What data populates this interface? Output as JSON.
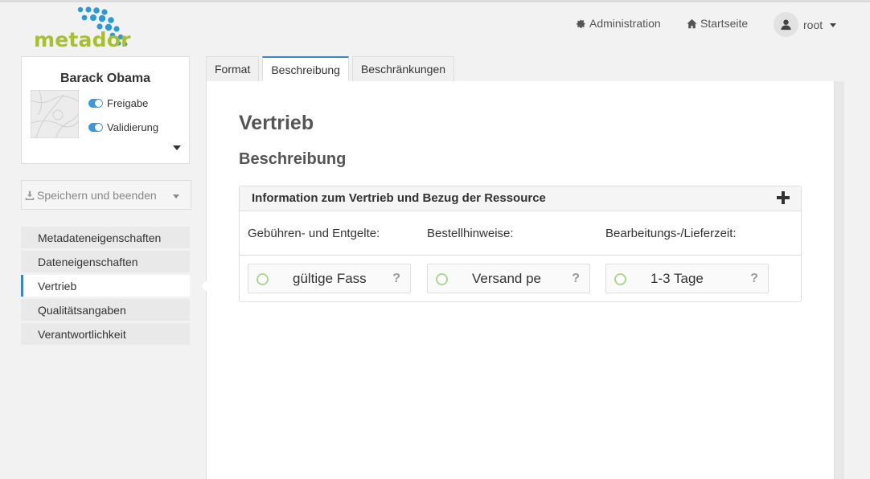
{
  "brand": {
    "name": "metador",
    "logo_color": "#a9bf2c",
    "dots_color": "#2a9ad6"
  },
  "topnav": {
    "administration": "Administration",
    "startseite": "Startseite",
    "user": "root"
  },
  "record": {
    "title": "Barack Obama",
    "toggles": [
      {
        "label": "Freigabe",
        "on": true
      },
      {
        "label": "Validierung",
        "on": true
      }
    ]
  },
  "save_button": {
    "label": "Speichern und beenden"
  },
  "sidenav": {
    "items": [
      {
        "label": "Metadateneigenschaften",
        "active": false
      },
      {
        "label": "Dateneigenschaften",
        "active": false
      },
      {
        "label": "Vertrieb",
        "active": true
      },
      {
        "label": "Qualitätsangaben",
        "active": false
      },
      {
        "label": "Verantwortlichkeit",
        "active": false
      }
    ]
  },
  "tabs": [
    {
      "label": "Format",
      "active": false
    },
    {
      "label": "Beschreibung",
      "active": true
    },
    {
      "label": "Beschränkungen",
      "active": false
    }
  ],
  "content": {
    "heading": "Vertrieb",
    "subheading": "Beschreibung",
    "box": {
      "title": "Information zum Vertrieb und Bezug der Ressource",
      "columns": [
        {
          "label": "Gebühren- und Entgelte:",
          "value": "gültige Fass"
        },
        {
          "label": "Bestellhinweise:",
          "value": "Versand pe"
        },
        {
          "label": "Bearbeitungs-/Lieferzeit:",
          "value": "1-3 Tage"
        }
      ],
      "help_symbol": "?"
    }
  },
  "colors": {
    "accent": "#3a87c8",
    "radio": "#a8d98f"
  }
}
